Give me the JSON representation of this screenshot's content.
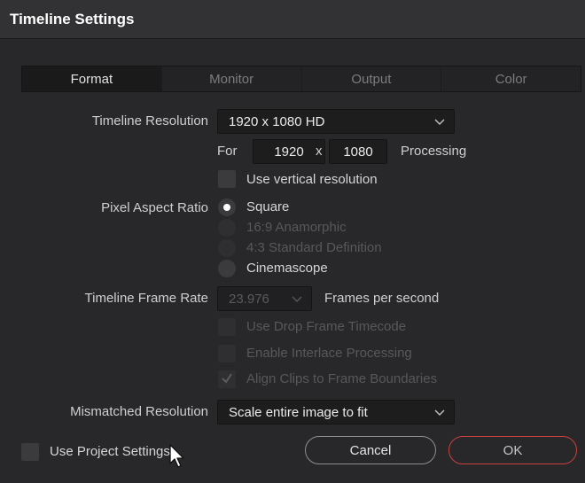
{
  "dialog": {
    "title": "Timeline Settings"
  },
  "tabs": [
    {
      "label": "Format",
      "active": true
    },
    {
      "label": "Monitor",
      "active": false
    },
    {
      "label": "Output",
      "active": false
    },
    {
      "label": "Color",
      "active": false
    }
  ],
  "format": {
    "timeline_resolution": {
      "label": "Timeline Resolution",
      "value": "1920 x 1080 HD",
      "for_label": "For",
      "width": "1920",
      "x_label": "x",
      "height": "1080",
      "processing_label": "Processing",
      "use_vertical_label": "Use vertical resolution",
      "use_vertical_checked": false
    },
    "pixel_aspect_ratio": {
      "label": "Pixel Aspect Ratio",
      "options": [
        {
          "label": "Square",
          "selected": true,
          "enabled": true
        },
        {
          "label": "16:9 Anamorphic",
          "selected": false,
          "enabled": false
        },
        {
          "label": "4:3 Standard Definition",
          "selected": false,
          "enabled": false
        },
        {
          "label": "Cinemascope",
          "selected": false,
          "enabled": true
        }
      ]
    },
    "frame_rate": {
      "label": "Timeline Frame Rate",
      "value": "23.976",
      "unit_label": "Frames per second",
      "enabled": false,
      "checkboxes": [
        {
          "label": "Use Drop Frame Timecode",
          "checked": false,
          "enabled": false
        },
        {
          "label": "Enable Interlace Processing",
          "checked": false,
          "enabled": false
        },
        {
          "label": "Align Clips to Frame Boundaries",
          "checked": true,
          "enabled": false
        }
      ]
    },
    "mismatched_resolution": {
      "label": "Mismatched Resolution",
      "value": "Scale entire image to fit"
    }
  },
  "footer": {
    "use_project_settings_label": "Use Project Settings",
    "use_project_settings_checked": false,
    "cancel_label": "Cancel",
    "ok_label": "OK"
  },
  "colors": {
    "ok_border": "#c9413d",
    "background": "#28282a"
  },
  "icons": {
    "dropdown": "chevron-down-icon",
    "checkmark": "checkmark-icon",
    "cursor": "mouse-pointer-icon"
  }
}
